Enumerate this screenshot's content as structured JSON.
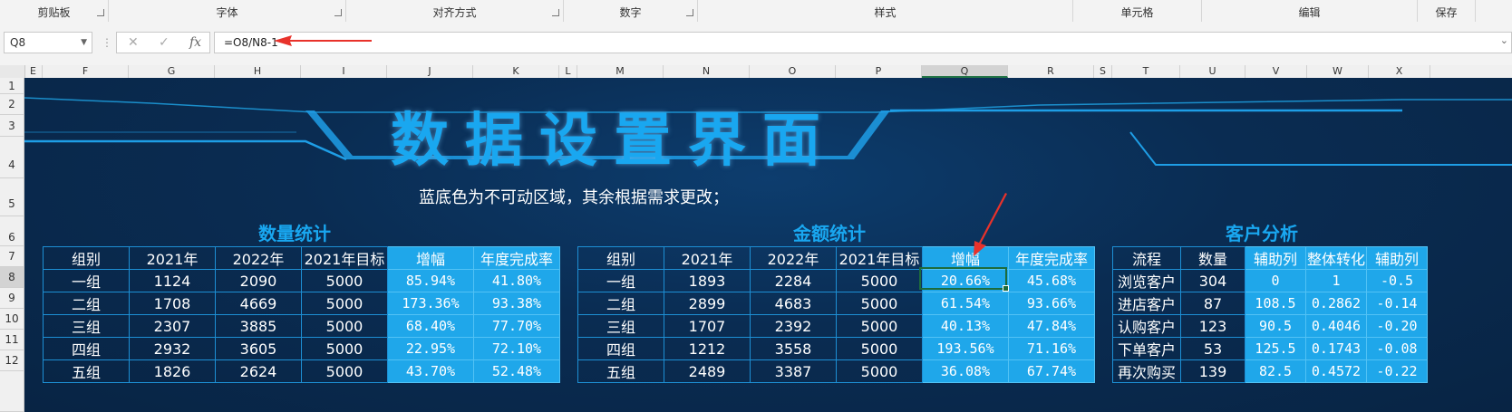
{
  "ribbon": {
    "groups": [
      {
        "label": "剪贴板",
        "launcher": true
      },
      {
        "label": "字体",
        "launcher": true
      },
      {
        "label": "对齐方式",
        "launcher": true
      },
      {
        "label": "数字",
        "launcher": true
      },
      {
        "label": "样式",
        "launcher": false
      },
      {
        "label": "单元格",
        "launcher": false
      },
      {
        "label": "编辑",
        "launcher": false
      },
      {
        "label": "保存",
        "launcher": false
      }
    ]
  },
  "formula_bar": {
    "name_box": "Q8",
    "cancel_icon": "✕",
    "enter_icon": "✓",
    "fx_icon": "fx",
    "formula": "=O8/N8-1"
  },
  "columns": [
    "E",
    "F",
    "G",
    "H",
    "I",
    "J",
    "K",
    "L",
    "M",
    "N",
    "O",
    "P",
    "Q",
    "R",
    "S",
    "T",
    "U",
    "V",
    "W",
    "X"
  ],
  "selected_column": "Q",
  "rows": [
    "1",
    "2",
    "3",
    "4",
    "5",
    "6",
    "7",
    "8",
    "9",
    "10",
    "11",
    "12"
  ],
  "selected_row": "8",
  "sheet": {
    "title": "数据设置界面",
    "notice": "蓝底色为不可动区域，其余根据需求更改；",
    "quantity": {
      "title": "数量统计",
      "headers": [
        "组别",
        "2021年",
        "2022年",
        "2021年目标",
        "增幅",
        "年度完成率"
      ],
      "rows": [
        [
          "一组",
          "1124",
          "2090",
          "5000",
          "85.94%",
          "41.80%"
        ],
        [
          "二组",
          "1708",
          "4669",
          "5000",
          "173.36%",
          "93.38%"
        ],
        [
          "三组",
          "2307",
          "3885",
          "5000",
          "68.40%",
          "77.70%"
        ],
        [
          "四组",
          "2932",
          "3605",
          "5000",
          "22.95%",
          "72.10%"
        ],
        [
          "五组",
          "1826",
          "2624",
          "5000",
          "43.70%",
          "52.48%"
        ]
      ]
    },
    "amount": {
      "title": "金额统计",
      "headers": [
        "组别",
        "2021年",
        "2022年",
        "2021年目标",
        "增幅",
        "年度完成率"
      ],
      "rows": [
        [
          "一组",
          "1893",
          "2284",
          "5000",
          "20.66%",
          "45.68%"
        ],
        [
          "二组",
          "2899",
          "4683",
          "5000",
          "61.54%",
          "93.66%"
        ],
        [
          "三组",
          "1707",
          "2392",
          "5000",
          "40.13%",
          "47.84%"
        ],
        [
          "四组",
          "1212",
          "3558",
          "5000",
          "193.56%",
          "71.16%"
        ],
        [
          "五组",
          "2489",
          "3387",
          "5000",
          "36.08%",
          "67.74%"
        ]
      ]
    },
    "customer": {
      "title": "客户分析",
      "headers": [
        "流程",
        "数量",
        "辅助列",
        "整体转化",
        "辅助列"
      ],
      "rows": [
        [
          "浏览客户",
          "304",
          "0",
          "1",
          "-0.5"
        ],
        [
          "进店客户",
          "87",
          "108.5",
          "0.2862",
          "-0.14"
        ],
        [
          "认购客户",
          "123",
          "90.5",
          "0.4046",
          "-0.20"
        ],
        [
          "下单客户",
          "53",
          "125.5",
          "0.1743",
          "-0.08"
        ],
        [
          "再次购买",
          "139",
          "82.5",
          "0.4572",
          "-0.22"
        ]
      ]
    }
  },
  "colors": {
    "title": "#19a7f0",
    "cell_fill": "#1fa7ea",
    "border": "#1d8fd4",
    "selection": "#1d6b3c",
    "arrow": "#e8322b"
  }
}
